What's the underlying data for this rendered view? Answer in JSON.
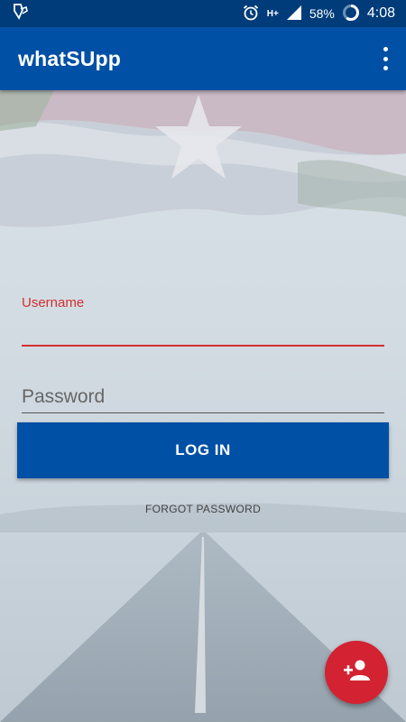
{
  "status_bar": {
    "left_icon": "cleaner-app-icon",
    "alarm_icon": "alarm-icon",
    "network_type": "H+",
    "signal_icon": "signal-icon",
    "battery_pct": "58%",
    "battery_icon": "battery-ring-icon",
    "time": "4:08"
  },
  "app_bar": {
    "title": "whatSUpp",
    "overflow_icon": "more-vertical-icon"
  },
  "form": {
    "username_label": "Username",
    "username_value": "",
    "password_placeholder": "Password",
    "login_label": "LOG IN",
    "forgot_label": "FORGOT PASSWORD"
  },
  "fab": {
    "icon": "add-person-icon"
  },
  "colors": {
    "primary": "#0050a5",
    "status_bar": "#003c7a",
    "accent_red": "#d32f2f",
    "fab": "#d32232"
  }
}
